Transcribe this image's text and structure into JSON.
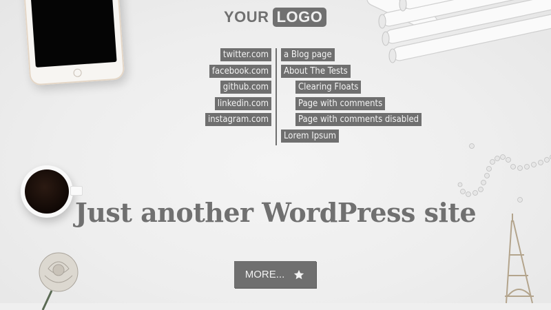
{
  "logo": {
    "part1": "YOUR",
    "part2": "LOGO"
  },
  "social_menu": [
    {
      "label": "twitter.com"
    },
    {
      "label": "facebook.com"
    },
    {
      "label": "github.com"
    },
    {
      "label": "linkedin.com"
    },
    {
      "label": "instagram.com"
    }
  ],
  "pages_menu": [
    {
      "label": "a Blog page"
    },
    {
      "label": "About The Tests"
    },
    {
      "label": "Clearing Floats"
    },
    {
      "label": "Page with comments"
    },
    {
      "label": "Page with comments disabled"
    },
    {
      "label": "Lorem Ipsum"
    }
  ],
  "site": {
    "title": "Just another WordPress site"
  },
  "cta": {
    "label": "MORE...",
    "icon": "star-icon"
  },
  "colors": {
    "accent": "#6f6f6f",
    "background": "#efefef"
  }
}
